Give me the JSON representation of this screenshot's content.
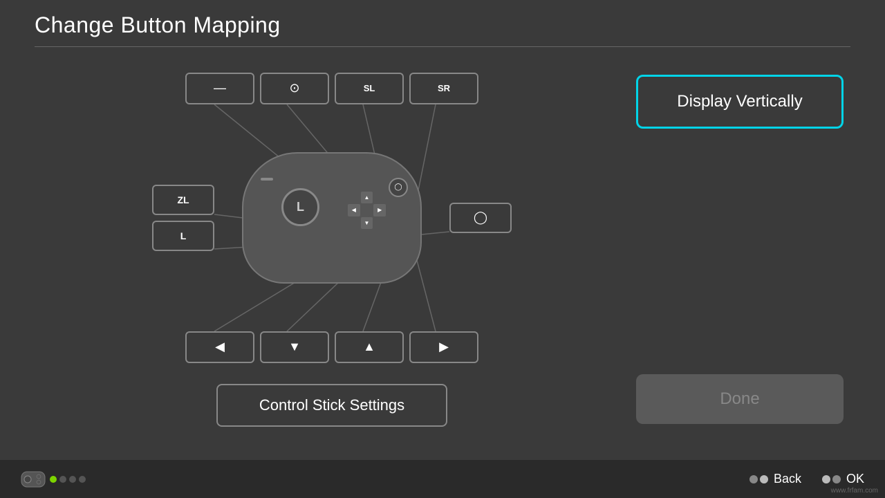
{
  "page": {
    "title": "Change Button Mapping"
  },
  "top_buttons": [
    {
      "id": "minus-btn",
      "icon": "minus",
      "symbol": "—"
    },
    {
      "id": "timer-btn",
      "icon": "timer",
      "symbol": "⊙"
    },
    {
      "id": "sl-btn",
      "icon": "sl",
      "symbol": "SL"
    },
    {
      "id": "sr-btn",
      "icon": "sr",
      "symbol": "SR"
    }
  ],
  "bottom_buttons": [
    {
      "id": "left-btn",
      "icon": "left",
      "symbol": "◀"
    },
    {
      "id": "down-btn",
      "icon": "down",
      "symbol": "▼"
    },
    {
      "id": "up-btn",
      "icon": "up",
      "symbol": "▲"
    },
    {
      "id": "right-btn",
      "icon": "right",
      "symbol": "▶"
    }
  ],
  "left_side_buttons": [
    {
      "id": "zl-btn",
      "label": "ZL"
    },
    {
      "id": "l-btn",
      "label": "L"
    }
  ],
  "right_side_button": {
    "id": "circle-btn",
    "symbol": "◯"
  },
  "analog_stick_label": "L",
  "control_stick_settings_label": "Control Stick Settings",
  "right_panel": {
    "display_vertically_label": "Display Vertically",
    "done_label": "Done"
  },
  "footer": {
    "back_label": "Back",
    "ok_label": "OK"
  },
  "indicators": [
    {
      "active": true
    },
    {
      "active": false
    },
    {
      "active": false
    },
    {
      "active": false
    }
  ],
  "watermark": "www.frfam.com",
  "colors": {
    "accent_cyan": "#00d4e8",
    "bg_dark": "#3a3a3a",
    "bg_footer": "#2a2a2a",
    "border_default": "#888888"
  }
}
